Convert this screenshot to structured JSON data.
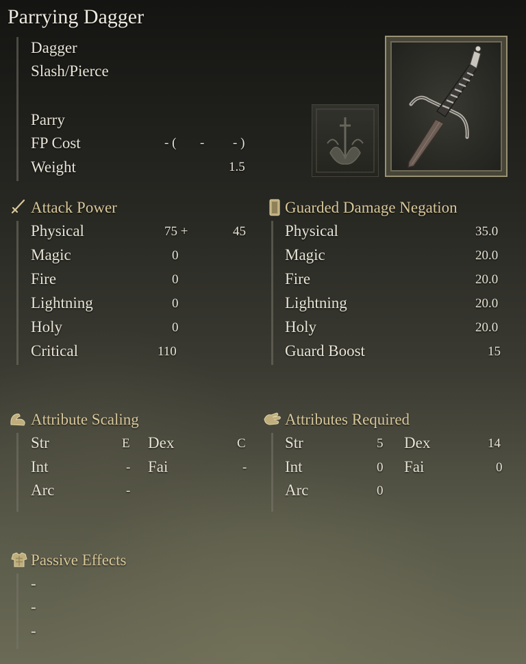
{
  "title": "Parrying Dagger",
  "info": {
    "type": "Dagger",
    "damage_type": "Slash/Pierce",
    "skill": "Parry",
    "fp_label": "FP Cost",
    "fp_a": "- (",
    "fp_b": "-",
    "fp_c": "- )",
    "weight_label": "Weight",
    "weight": "1.5"
  },
  "attack_power": {
    "header": "Attack Power",
    "rows": [
      {
        "label": "Physical",
        "value": "75 +",
        "extra": "45"
      },
      {
        "label": "Magic",
        "value": "0"
      },
      {
        "label": "Fire",
        "value": "0"
      },
      {
        "label": "Lightning",
        "value": "0"
      },
      {
        "label": "Holy",
        "value": "0"
      },
      {
        "label": "Critical",
        "value": "110"
      }
    ]
  },
  "guard": {
    "header": "Guarded Damage Negation",
    "rows": [
      {
        "label": "Physical",
        "value": "35.0"
      },
      {
        "label": "Magic",
        "value": "20.0"
      },
      {
        "label": "Fire",
        "value": "20.0"
      },
      {
        "label": "Lightning",
        "value": "20.0"
      },
      {
        "label": "Holy",
        "value": "20.0"
      },
      {
        "label": "Guard Boost",
        "value": "15"
      }
    ]
  },
  "scaling": {
    "header": "Attribute Scaling",
    "str_label": "Str",
    "str": "E",
    "dex_label": "Dex",
    "dex": "C",
    "int_label": "Int",
    "int": "-",
    "fai_label": "Fai",
    "fai": "-",
    "arc_label": "Arc",
    "arc": "-"
  },
  "required": {
    "header": "Attributes Required",
    "str_label": "Str",
    "str": "5",
    "dex_label": "Dex",
    "dex": "14",
    "int_label": "Int",
    "int": "0",
    "fai_label": "Fai",
    "fai": "0",
    "arc_label": "Arc",
    "arc": "0"
  },
  "passive": {
    "header": "Passive Effects",
    "items": [
      "-",
      "-",
      "-"
    ]
  },
  "icons": {
    "attack": "sword-icon",
    "guard": "shield-icon",
    "scaling": "flexed-arm-icon",
    "required": "hand-icon",
    "passive": "armor-icon",
    "skill": "skill-emblem-icon",
    "weapon": "dagger-image"
  }
}
